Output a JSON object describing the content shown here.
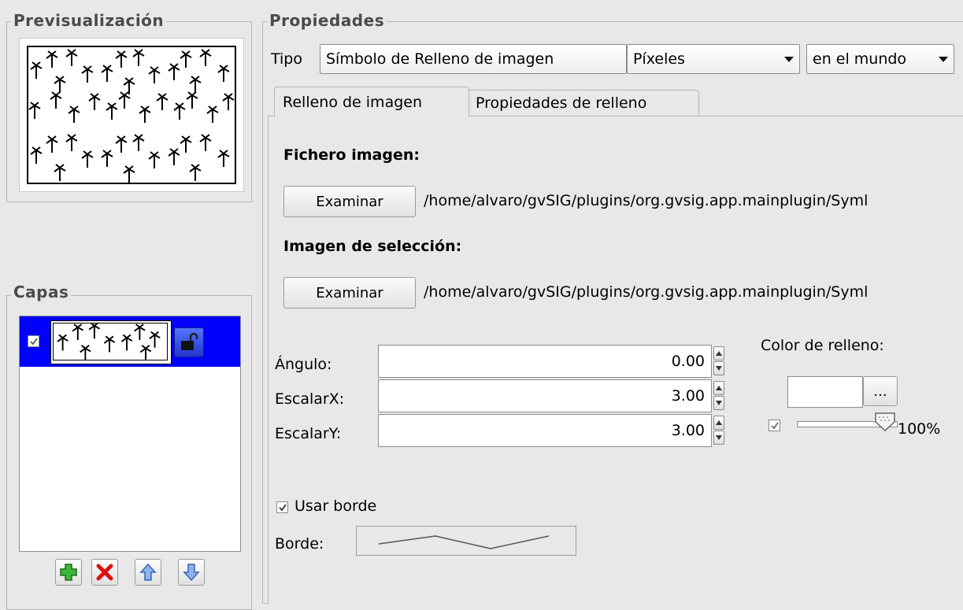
{
  "preview": {
    "title": "Previsualización"
  },
  "layers": {
    "title": "Capas",
    "items": [
      {
        "checked": true,
        "locked": false
      }
    ],
    "toolbar": {
      "add_icon": "add-icon",
      "remove_icon": "remove-icon",
      "up_icon": "arrow-up-icon",
      "down_icon": "arrow-down-icon"
    }
  },
  "properties": {
    "title": "Propiedades",
    "type_label": "Tipo",
    "type_value": "Símbolo de Relleno de imagen",
    "units_value": "Píxeles",
    "reference_value": "en el mundo",
    "tabs": [
      {
        "label": "Relleno de imagen",
        "active": true
      },
      {
        "label": "Propiedades de relleno",
        "active": false
      }
    ],
    "image_file": {
      "heading": "Fichero imagen:",
      "browse_label": "Examinar",
      "path": "/home/alvaro/gvSIG/plugins/org.gvsig.app.mainplugin/Syml"
    },
    "selection_image": {
      "heading": "Imagen de selección:",
      "browse_label": "Examinar",
      "path": "/home/alvaro/gvSIG/plugins/org.gvsig.app.mainplugin/Syml"
    },
    "angle": {
      "label": "Ángulo:",
      "value": "0.00"
    },
    "scale_x": {
      "label": "EscalarX:",
      "value": "3.00"
    },
    "scale_y": {
      "label": "EscalarY:",
      "value": "3.00"
    },
    "fill_color": {
      "label": "Color de relleno:",
      "picker_label": "...",
      "alpha_enabled": true,
      "alpha_percent": "100%",
      "alpha_fraction": 1.0
    },
    "use_border": {
      "label": "Usar borde",
      "checked": true
    },
    "border": {
      "label": "Borde:"
    }
  },
  "colors": {
    "selection": "#0000ff",
    "background": "#e8e8e8"
  }
}
